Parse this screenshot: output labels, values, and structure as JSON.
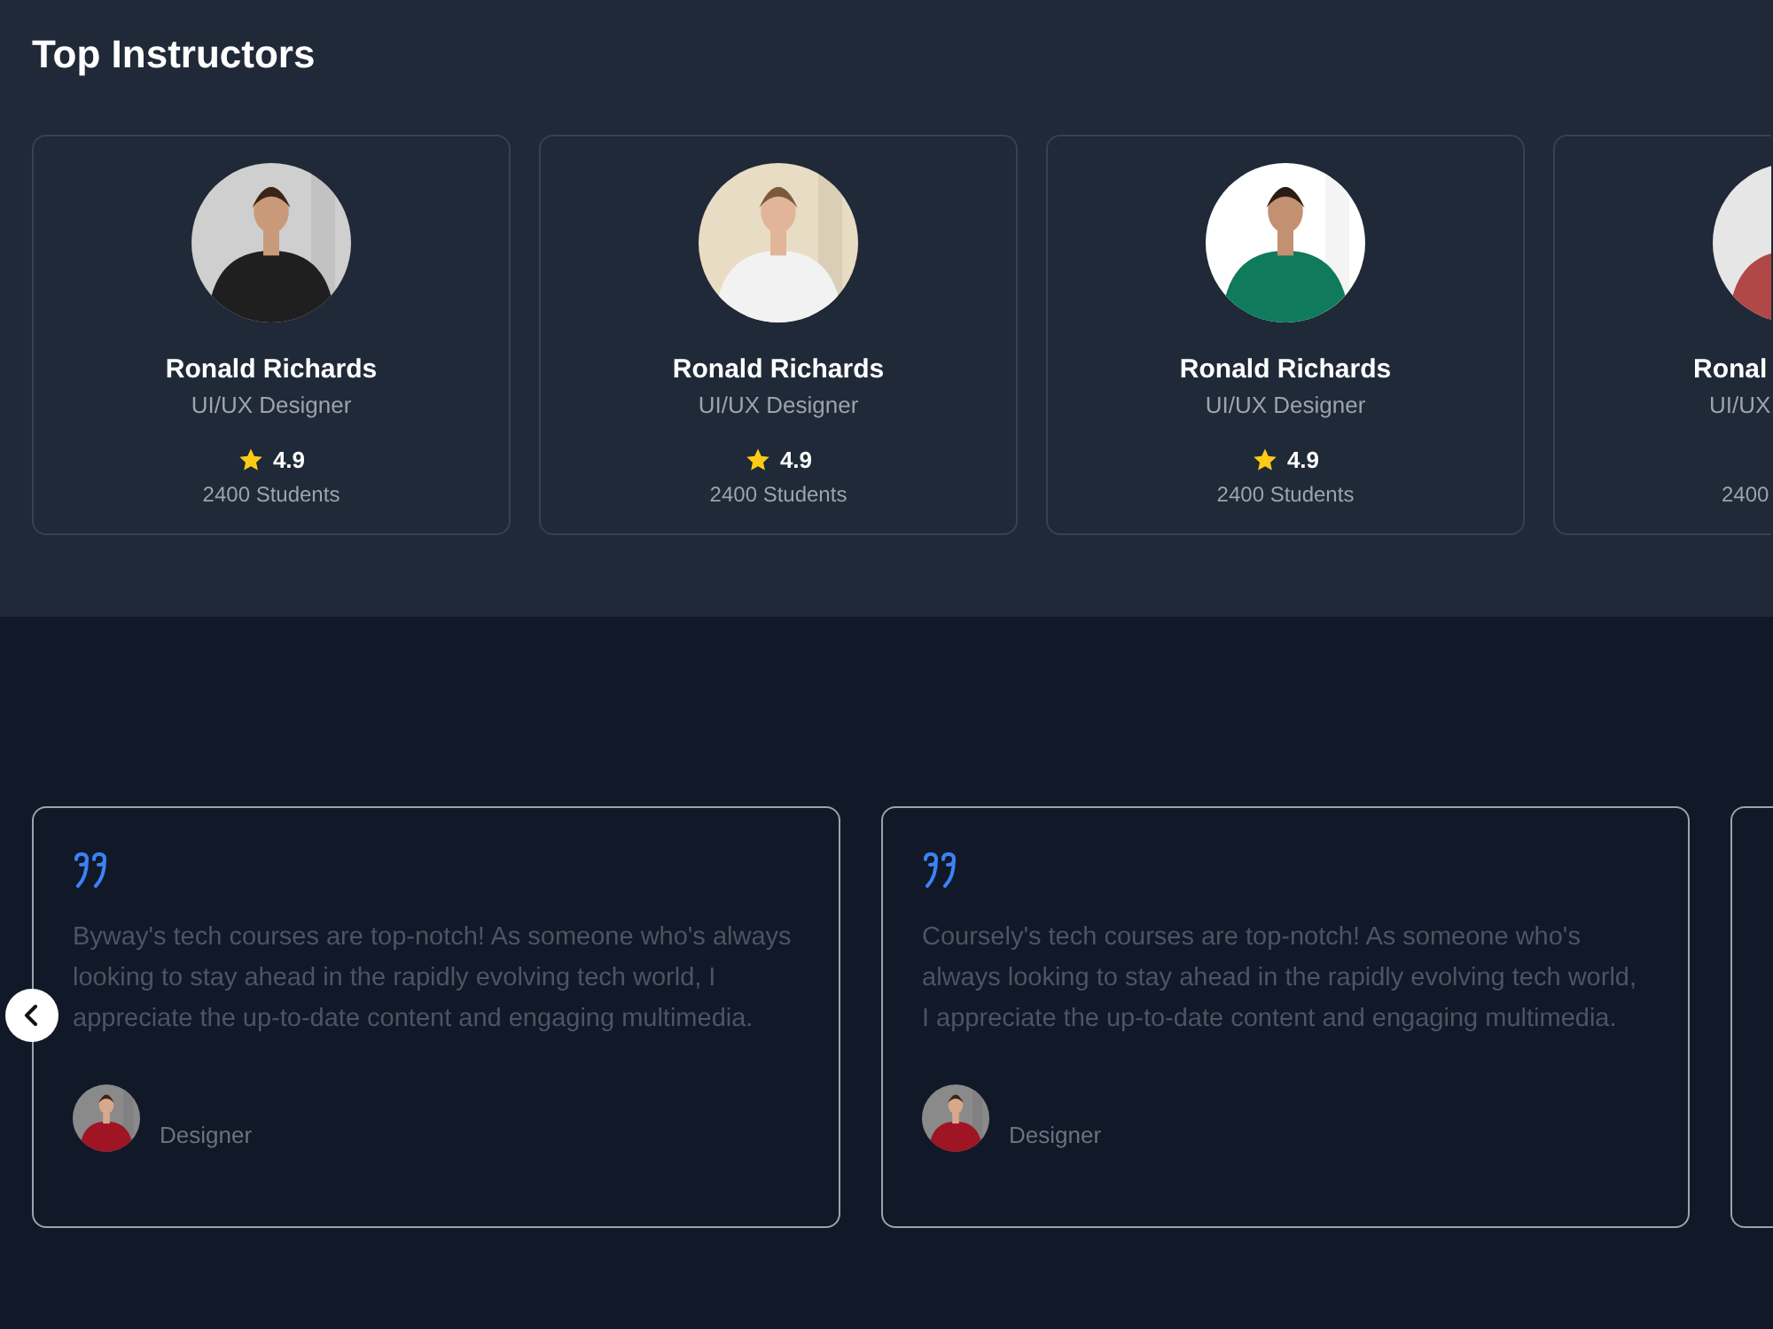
{
  "instructors": {
    "title": "Top Instructors",
    "cards": [
      {
        "kind": "full",
        "name": "Ronald Richards",
        "role": "UI/UX Designer",
        "rating": "4.9",
        "students": "2400 Students"
      },
      {
        "kind": "full",
        "name": "Ronald Richards",
        "role": "UI/UX Designer",
        "rating": "4.9",
        "students": "2400 Students"
      },
      {
        "kind": "full",
        "name": "Ronald Richards",
        "role": "UI/UX Designer",
        "rating": "4.9",
        "students": "2400 Students"
      },
      {
        "kind": "partial",
        "name": "Ronal",
        "role": "UI/UX",
        "students": "2400"
      }
    ]
  },
  "testimonials": {
    "cards": [
      {
        "kind": "full",
        "quote": "Byway's tech courses are top-notch! As someone who's always looking to stay ahead in the rapidly evolving tech world, I appreciate the up-to-date content and engaging multimedia.",
        "role": "Designer"
      },
      {
        "kind": "full",
        "quote": "Coursely's tech courses are top-notch! As someone who's always looking to stay ahead in the rapidly evolving tech world, I appreciate the up-to-date content and engaging multimedia.",
        "role": "Designer"
      },
      {
        "kind": "partial"
      }
    ]
  }
}
